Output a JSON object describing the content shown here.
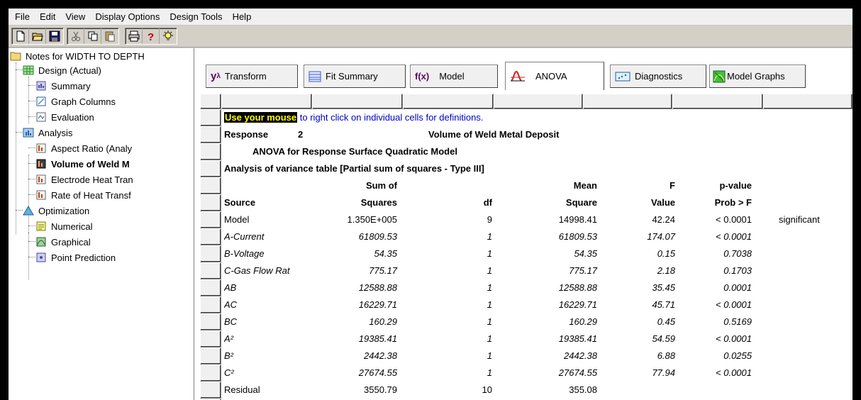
{
  "menu": [
    "File",
    "Edit",
    "View",
    "Display Options",
    "Design Tools",
    "Help"
  ],
  "tree": {
    "root": "Notes for WIDTH TO DEPTH",
    "design": "Design (Actual)",
    "design_children": [
      "Summary",
      "Graph Columns",
      "Evaluation"
    ],
    "analysis": "Analysis",
    "analysis_children": [
      "Aspect Ratio (Analy",
      "Volume of Weld M",
      "Electrode Heat Tran",
      "Rate of Heat Transf"
    ],
    "optimization": "Optimization",
    "optimization_children": [
      "Numerical",
      "Graphical",
      "Point Prediction"
    ]
  },
  "tabs": {
    "transform": "Transform",
    "transform_prefix": "y",
    "fit_summary": "Fit Summary",
    "model": "Model",
    "model_prefix": "f(x)",
    "anova": "ANOVA",
    "diagnostics": "Diagnostics",
    "model_graphs": "Model Graphs"
  },
  "report": {
    "hint_highlight": "Use your mouse",
    "hint_rest": " to right click on individual cells for definitions.",
    "response_label": "Response",
    "response_number": "2",
    "response_name": "Volume of Weld Metal Deposit",
    "model_title": "ANOVA for Response Surface Quadratic Model",
    "table_title": "Analysis of variance table [Partial sum of squares - Type III]",
    "header1": {
      "ss": "Sum of",
      "ms": "Mean",
      "f": "F",
      "p": "p-value"
    },
    "header2": {
      "src": "Source",
      "ss": "Squares",
      "df": "df",
      "ms": "Square",
      "f": "Value",
      "p": "Prob > F"
    },
    "rows": [
      {
        "src": "Model",
        "ss": "1.350E+005",
        "df": "9",
        "ms": "14998.41",
        "f": "42.24",
        "p": "< 0.0001",
        "note": "significant"
      },
      {
        "src": "A-Current",
        "ss": "61809.53",
        "df": "1",
        "ms": "61809.53",
        "f": "174.07",
        "p": "< 0.0001",
        "note": ""
      },
      {
        "src": "B-Voltage",
        "ss": "54.35",
        "df": "1",
        "ms": "54.35",
        "f": "0.15",
        "p": "0.7038",
        "note": ""
      },
      {
        "src": "C-Gas Flow Rat",
        "ss": "775.17",
        "df": "1",
        "ms": "775.17",
        "f": "2.18",
        "p": "0.1703",
        "note": ""
      },
      {
        "src": "AB",
        "ss": "12588.88",
        "df": "1",
        "ms": "12588.88",
        "f": "35.45",
        "p": "0.0001",
        "note": ""
      },
      {
        "src": "AC",
        "ss": "16229.71",
        "df": "1",
        "ms": "16229.71",
        "f": "45.71",
        "p": "< 0.0001",
        "note": ""
      },
      {
        "src": "BC",
        "ss": "160.29",
        "df": "1",
        "ms": "160.29",
        "f": "0.45",
        "p": "0.5169",
        "note": ""
      },
      {
        "src": "A²",
        "ss": "19385.41",
        "df": "1",
        "ms": "19385.41",
        "f": "54.59",
        "p": "< 0.0001",
        "note": ""
      },
      {
        "src": "B²",
        "ss": "2442.38",
        "df": "1",
        "ms": "2442.38",
        "f": "6.88",
        "p": "0.0255",
        "note": ""
      },
      {
        "src": "C²",
        "ss": "27674.55",
        "df": "1",
        "ms": "27674.55",
        "f": "77.94",
        "p": "< 0.0001",
        "note": ""
      },
      {
        "src": "Residual",
        "ss": "3550.79",
        "df": "10",
        "ms": "355.08",
        "f": "",
        "p": "",
        "note": ""
      }
    ]
  }
}
